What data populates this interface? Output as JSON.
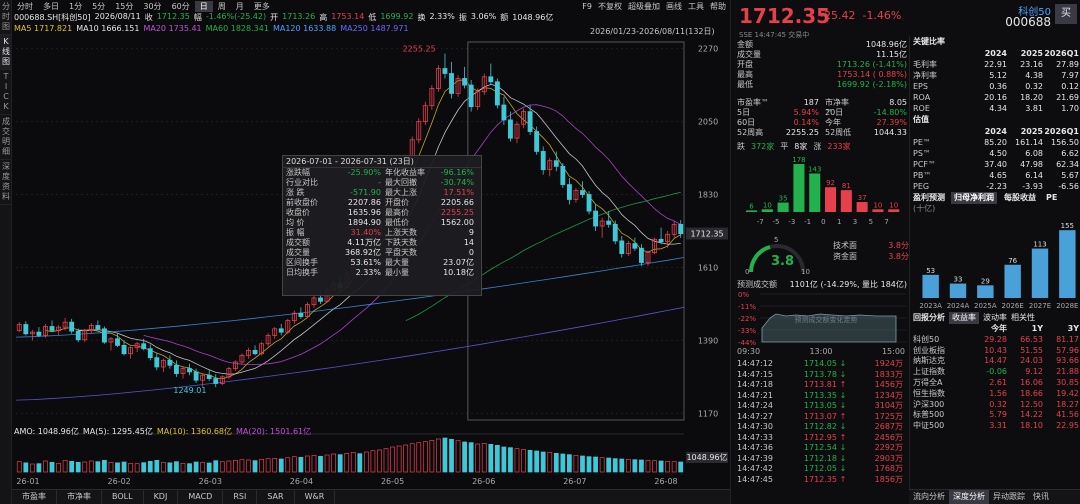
{
  "side_tabs": [
    "分时图",
    "K线图",
    "TICK",
    "成交明细",
    "深度资料"
  ],
  "period_bar": {
    "items": [
      "分时",
      "多日",
      "1分",
      "5分",
      "15分",
      "30分",
      "60分",
      "日",
      "周",
      "月",
      "更多"
    ],
    "active": "日",
    "right_items": [
      "F9",
      "不复权",
      "超级叠加",
      "画线",
      "工具",
      "帮助"
    ]
  },
  "info_row": {
    "code": "000688.SH[科创50]",
    "date": "2026/08/11",
    "close_label": "收",
    "close": "1712.35",
    "change_label": "幅",
    "change": "-1.46%(-25.42)",
    "open_label": "开",
    "open": "1713.26",
    "high_label": "高",
    "high": "1753.14",
    "low_label": "低",
    "low": "1699.92",
    "turnover_label": "换",
    "turnover": "2.33%",
    "amp_label": "振",
    "amp": "3.06%",
    "amount_label": "额",
    "amount": "1048.96亿"
  },
  "ma_row": [
    {
      "label": "MA5",
      "value": "1717.821",
      "color": "#e0c035"
    },
    {
      "label": "MA10",
      "value": "1666.151",
      "color": "#e6e6e6"
    },
    {
      "label": "MA20",
      "value": "1735.41",
      "color": "#c050e0"
    },
    {
      "label": "MA60",
      "value": "1828.341",
      "color": "#22b14c"
    },
    {
      "label": "MA120",
      "value": "1633.88",
      "color": "#4aa3ff"
    },
    {
      "label": "MA250",
      "value": "1487.971",
      "color": "#6a6aff"
    }
  ],
  "range_label": "2026/01/23-2026/08/11(132日)",
  "chart_data": {
    "type": "candlestick",
    "y_ticks": [
      2270,
      2050,
      1830,
      1610,
      1390,
      1170
    ],
    "ylim": [
      1150,
      2290
    ],
    "x_ticks": [
      "26-01",
      "26-02",
      "26-03",
      "26-04",
      "26-05",
      "26-06",
      "26-07",
      "26-08"
    ],
    "annotations": [
      {
        "text": "2255.25"
      },
      {
        "text": "1249.01"
      }
    ],
    "last_price_tag": "1712.35",
    "candles": [
      [
        1420,
        1445,
        1415,
        1438
      ],
      [
        1438,
        1448,
        1405,
        1410
      ],
      [
        1410,
        1422,
        1390,
        1415
      ],
      [
        1415,
        1430,
        1400,
        1405
      ],
      [
        1405,
        1440,
        1398,
        1432
      ],
      [
        1432,
        1450,
        1415,
        1420
      ],
      [
        1420,
        1436,
        1405,
        1430
      ],
      [
        1430,
        1458,
        1420,
        1445
      ],
      [
        1445,
        1455,
        1410,
        1418
      ],
      [
        1418,
        1426,
        1385,
        1392
      ],
      [
        1392,
        1425,
        1385,
        1420
      ],
      [
        1420,
        1442,
        1412,
        1435
      ],
      [
        1435,
        1450,
        1420,
        1425
      ],
      [
        1425,
        1432,
        1380,
        1385
      ],
      [
        1385,
        1400,
        1360,
        1395
      ],
      [
        1395,
        1410,
        1370,
        1375
      ],
      [
        1375,
        1390,
        1345,
        1350
      ],
      [
        1350,
        1372,
        1335,
        1368
      ],
      [
        1368,
        1385,
        1355,
        1380
      ],
      [
        1380,
        1395,
        1360,
        1365
      ],
      [
        1365,
        1378,
        1330,
        1338
      ],
      [
        1338,
        1352,
        1300,
        1310
      ],
      [
        1310,
        1335,
        1295,
        1330
      ],
      [
        1330,
        1345,
        1305,
        1315
      ],
      [
        1315,
        1330,
        1280,
        1290
      ],
      [
        1290,
        1312,
        1275,
        1305
      ],
      [
        1305,
        1320,
        1285,
        1295
      ],
      [
        1295,
        1305,
        1262,
        1270
      ],
      [
        1270,
        1290,
        1250,
        1285
      ],
      [
        1285,
        1300,
        1268,
        1275
      ],
      [
        1275,
        1288,
        1249,
        1260
      ],
      [
        1260,
        1285,
        1255,
        1280
      ],
      [
        1280,
        1310,
        1275,
        1305
      ],
      [
        1305,
        1330,
        1298,
        1325
      ],
      [
        1325,
        1350,
        1318,
        1345
      ],
      [
        1345,
        1368,
        1335,
        1360
      ],
      [
        1360,
        1375,
        1345,
        1350
      ],
      [
        1350,
        1385,
        1345,
        1380
      ],
      [
        1380,
        1412,
        1372,
        1405
      ],
      [
        1405,
        1430,
        1395,
        1425
      ],
      [
        1425,
        1440,
        1405,
        1415
      ],
      [
        1415,
        1455,
        1410,
        1450
      ],
      [
        1450,
        1480,
        1440,
        1472
      ],
      [
        1472,
        1490,
        1455,
        1462
      ],
      [
        1462,
        1505,
        1458,
        1498
      ],
      [
        1498,
        1525,
        1488,
        1518
      ],
      [
        1518,
        1540,
        1500,
        1508
      ],
      [
        1508,
        1548,
        1505,
        1542
      ],
      [
        1542,
        1570,
        1535,
        1562
      ],
      [
        1562,
        1580,
        1540,
        1550
      ],
      [
        1550,
        1598,
        1548,
        1592
      ],
      [
        1592,
        1640,
        1585,
        1632
      ],
      [
        1632,
        1650,
        1610,
        1620
      ],
      [
        1620,
        1668,
        1615,
        1660
      ],
      [
        1660,
        1712,
        1655,
        1705
      ],
      [
        1705,
        1760,
        1700,
        1752
      ],
      [
        1752,
        1800,
        1745,
        1792
      ],
      [
        1792,
        1860,
        1785,
        1850
      ],
      [
        1850,
        1905,
        1840,
        1895
      ],
      [
        1895,
        1950,
        1880,
        1940
      ],
      [
        1940,
        2005,
        1930,
        1995
      ],
      [
        1995,
        2060,
        1985,
        2050
      ],
      [
        2050,
        2110,
        2040,
        2098
      ],
      [
        2098,
        2160,
        2085,
        2150
      ],
      [
        2150,
        2220,
        2140,
        2210
      ],
      [
        2210,
        2255,
        2180,
        2195
      ],
      [
        2195,
        2230,
        2120,
        2135
      ],
      [
        2135,
        2190,
        2125,
        2180
      ],
      [
        2180,
        2215,
        2150,
        2160
      ],
      [
        2160,
        2175,
        2080,
        2095
      ],
      [
        2095,
        2150,
        2085,
        2140
      ],
      [
        2140,
        2195,
        2130,
        2185
      ],
      [
        2185,
        2225,
        2160,
        2170
      ],
      [
        2170,
        2180,
        2090,
        2100
      ],
      [
        2100,
        2125,
        2040,
        2055
      ],
      [
        2055,
        2080,
        1990,
        2000
      ],
      [
        2000,
        2050,
        1985,
        2042
      ],
      [
        2042,
        2090,
        2030,
        2080
      ],
      [
        2080,
        2100,
        2010,
        2020
      ],
      [
        2020,
        2035,
        1950,
        1960
      ],
      [
        1960,
        1975,
        1890,
        1905
      ],
      [
        1905,
        1940,
        1885,
        1932
      ],
      [
        1932,
        1960,
        1900,
        1915
      ],
      [
        1915,
        1925,
        1850,
        1860
      ],
      [
        1860,
        1880,
        1800,
        1815
      ],
      [
        1815,
        1850,
        1805,
        1842
      ],
      [
        1842,
        1870,
        1820,
        1830
      ],
      [
        1830,
        1840,
        1770,
        1780
      ],
      [
        1780,
        1800,
        1720,
        1735
      ],
      [
        1735,
        1760,
        1700,
        1750
      ],
      [
        1750,
        1780,
        1730,
        1740
      ],
      [
        1740,
        1752,
        1680,
        1690
      ],
      [
        1690,
        1705,
        1640,
        1652
      ],
      [
        1652,
        1690,
        1645,
        1682
      ],
      [
        1682,
        1700,
        1660,
        1668
      ],
      [
        1668,
        1680,
        1615,
        1625
      ],
      [
        1625,
        1660,
        1615,
        1655
      ],
      [
        1655,
        1700,
        1650,
        1695
      ],
      [
        1695,
        1730,
        1680,
        1688
      ],
      [
        1688,
        1720,
        1670,
        1710
      ],
      [
        1710,
        1750,
        1700,
        1740
      ],
      [
        1740,
        1753,
        1699,
        1712
      ]
    ],
    "volumes": [
      62,
      55,
      48,
      50,
      66,
      58,
      52,
      70,
      64,
      58,
      60,
      66,
      62,
      70,
      58,
      55,
      60,
      52,
      50,
      56,
      64,
      70,
      58,
      55,
      62,
      52,
      50,
      60,
      58,
      54,
      68,
      62,
      66,
      70,
      74,
      72,
      68,
      76,
      80,
      82,
      78,
      86,
      92,
      88,
      96,
      100,
      94,
      102,
      108,
      104,
      112,
      118,
      110,
      120,
      128,
      132,
      140,
      150,
      156,
      162,
      170,
      176,
      182,
      190,
      198,
      204,
      196,
      188,
      180,
      176,
      168,
      172,
      166,
      160,
      150,
      146,
      140,
      136,
      130,
      126,
      120,
      118,
      112,
      108,
      104,
      100,
      96,
      92,
      90,
      86,
      84,
      80,
      78,
      76,
      74,
      72,
      70,
      68,
      66,
      64,
      62,
      60
    ],
    "amo_row": [
      {
        "label": "AMO:",
        "value": "1048.96亿",
        "color": "#e6e6e6"
      },
      {
        "label": "MA(5):",
        "value": "1295.45亿",
        "color": "#e6e6e6"
      },
      {
        "label": "MA(10):",
        "value": "1360.68亿",
        "color": "#e0c035"
      },
      {
        "label": "MA(20):",
        "value": "1501.61亿",
        "color": "#c050e0"
      }
    ],
    "vol_y_label": "1048.96亿"
  },
  "popup": {
    "header": "2026-07-01 - 2026-07-31 (23日)",
    "rows": [
      [
        "涨跌幅",
        "-25.90%",
        "年化收益率",
        "-96.16%"
      ],
      [
        "行业对比",
        "-",
        "最大回撤",
        "-30.74%"
      ],
      [
        "涨 跌",
        "-571.90",
        "最大上涨",
        "17.51%"
      ],
      [
        "前收盘价",
        "2207.86",
        "开盘价",
        "2205.66"
      ],
      [
        "收盘价",
        "1635.96",
        "最高价",
        "2255.25"
      ],
      [
        "均 价",
        "1894.90",
        "最低价",
        "1562.00"
      ],
      [
        "振 幅",
        "31.40%",
        "上涨天数",
        "9"
      ],
      [
        "成交额",
        "4.11万亿",
        "下跌天数",
        "14"
      ],
      [
        "成交量",
        "368.92亿",
        "平盘天数",
        "0"
      ],
      [
        "区间换手",
        "53.61%",
        "最大量",
        "23.07亿"
      ],
      [
        "日均换手",
        "2.33%",
        "最小量",
        "10.18亿"
      ]
    ]
  },
  "bottom_tabs": [
    "市盈率",
    "市净率",
    "BOLL",
    "KDJ",
    "MACD",
    "RSI",
    "SAR",
    "W&R"
  ],
  "quote": {
    "price": "1712.35",
    "change": "-25.42",
    "pct": "-1.46%",
    "name": "科创50",
    "code": "000688",
    "buy": "买",
    "sse": "SSE  14:47:45  交易中"
  },
  "stats": [
    [
      "金额",
      "1048.96亿"
    ],
    [
      "成交量",
      "11.15亿"
    ],
    [
      "开盘",
      "1713.26 (-1.41%)"
    ],
    [
      "最高",
      "1753.14 ( 0.88%)"
    ],
    [
      "最低",
      "1699.92 (-2.18%)"
    ]
  ],
  "stats2": [
    [
      "市盈率™",
      "187",
      "市净率™",
      "8.05"
    ],
    [
      "5日",
      "5.94%",
      "20日",
      "-14.80%"
    ],
    [
      "60日",
      "0.14%",
      "今年",
      "27.39%"
    ],
    [
      "52周高",
      "2255.25",
      "52周低",
      "1044.33"
    ]
  ],
  "adv": {
    "down_label": "跌",
    "down": "372家",
    "flat_label": "平",
    "flat": "8家",
    "up_label": "涨",
    "up": "233家"
  },
  "distribution": {
    "labels": [
      "-7",
      "-5",
      "-3",
      "-1",
      "0",
      "1",
      "3",
      "5",
      "7"
    ],
    "values": [
      6,
      10,
      35,
      178,
      143,
      92,
      81,
      37,
      10,
      10
    ],
    "colors": [
      "#22b14c",
      "#22b14c",
      "#22b14c",
      "#22b14c",
      "#22b14c",
      "#e5404b",
      "#e5404b",
      "#e5404b",
      "#e5404b",
      "#e5404b"
    ]
  },
  "gauge": {
    "value": "3.8",
    "scale_min": "0",
    "scale_mid": "5",
    "scale_max": "10",
    "tech_label": "技术面",
    "tech": "3.8分",
    "fund_label": "资金面",
    "fund": "3.8分"
  },
  "vol_pred": {
    "label": "预测成交额",
    "value": "1101亿 (-14.29%, 量比 184亿)"
  },
  "minute": {
    "y_labels": [
      "0%",
      "-11%",
      "-22%",
      "-33%",
      "-44%"
    ],
    "x_labels": [
      "09:30",
      "13:00",
      "15:00"
    ],
    "watermark": "预测成交额变化走势"
  },
  "ticks": [
    [
      "14:47:12",
      "1714.05",
      "↓",
      "1924万"
    ],
    [
      "14:47:15",
      "1713.78",
      "↓",
      "1833万"
    ],
    [
      "14:47:18",
      "1713.81",
      "↑",
      "1456万"
    ],
    [
      "14:47:21",
      "1713.35",
      "↓",
      "1234万"
    ],
    [
      "14:47:24",
      "1713.05",
      "↓",
      "3104万"
    ],
    [
      "14:47:27",
      "1713.07",
      "↑",
      "1725万"
    ],
    [
      "14:47:30",
      "1712.82",
      "↓",
      "2687万"
    ],
    [
      "14:47:33",
      "1712.95",
      "↑",
      "2456万"
    ],
    [
      "14:47:36",
      "1712.54",
      "↓",
      "2292万"
    ],
    [
      "14:47:39",
      "1712.18",
      "↓",
      "2903万"
    ],
    [
      "14:47:42",
      "1712.05",
      "↓",
      "1768万"
    ],
    [
      "14:47:45",
      "1712.35",
      "↑",
      "1856万"
    ]
  ],
  "fund": {
    "key_title": "关键比率",
    "key_hdr": [
      "",
      "2024",
      "2025",
      "2026Q1"
    ],
    "key_rows": [
      [
        "毛利率",
        "22.91",
        "23.16",
        "27.89"
      ],
      [
        "净利率",
        "5.12",
        "4.38",
        "7.97"
      ],
      [
        "EPS",
        "0.36",
        "0.32",
        "0.12"
      ],
      [
        "ROA",
        "20.16",
        "18.20",
        "21.69"
      ],
      [
        "ROE",
        "4.34",
        "3.81",
        "1.70"
      ]
    ],
    "val_title": "估值",
    "val_hdr": [
      "",
      "2024",
      "2025",
      "2026Q1"
    ],
    "val_rows": [
      [
        "PE™",
        "85.20",
        "161.14",
        "156.50"
      ],
      [
        "PS™",
        "4.50",
        "6.08",
        "6.62"
      ],
      [
        "PCF™",
        "37.40",
        "47.98",
        "62.34"
      ],
      [
        "PB™",
        "4.65",
        "6.14",
        "5.67"
      ],
      [
        "PEG",
        "-2.23",
        "-3.93",
        "-6.56"
      ]
    ],
    "profit_title": "盈利预测",
    "profit_tabs": [
      "归母净利润",
      "每股收益",
      "PE"
    ],
    "profit_unit": "(十亿)",
    "profit_bars": {
      "categories": [
        "2023A",
        "2024A",
        "2025A",
        "2026E",
        "2027E",
        "2028E"
      ],
      "values": [
        53,
        33,
        29,
        76,
        113,
        155
      ]
    },
    "ret_title": "回报分析",
    "ret_tabs": [
      "收益率",
      "波动率",
      "相关性"
    ],
    "ret_hdr": [
      "",
      "今年",
      "1Y",
      "3Y"
    ],
    "ret_rows": [
      [
        "科创50",
        "29.28",
        "66.53",
        "81.17"
      ],
      [
        "创业板指",
        "10.43",
        "51.55",
        "57.96"
      ],
      [
        "纳斯达克",
        "14.47",
        "24.03",
        "93.66"
      ],
      [
        "上证指数",
        "-0.06",
        "9.12",
        "21.88"
      ],
      [
        "万得全A",
        "2.61",
        "16.06",
        "30.85"
      ],
      [
        "恒生指数",
        "1.56",
        "18.66",
        "19.42"
      ],
      [
        "沪深300",
        "0.32",
        "12.50",
        "18.27"
      ],
      [
        "标普500",
        "5.79",
        "14.22",
        "41.56"
      ],
      [
        "中证500",
        "3.31",
        "18.10",
        "22.95"
      ]
    ],
    "bottom_tabs": [
      "流向分析",
      "深度分析",
      "异动跟踪",
      "快讯"
    ],
    "bottom_active": "深度分析"
  },
  "colors": {
    "up": "#e5404b",
    "down": "#22b14c",
    "ma5": "#e0c035",
    "ma10": "#e6e6e6",
    "ma20": "#c050e0",
    "ma60": "#22b14c",
    "ma120": "#4aa3ff",
    "ma250": "#6a6aff"
  }
}
